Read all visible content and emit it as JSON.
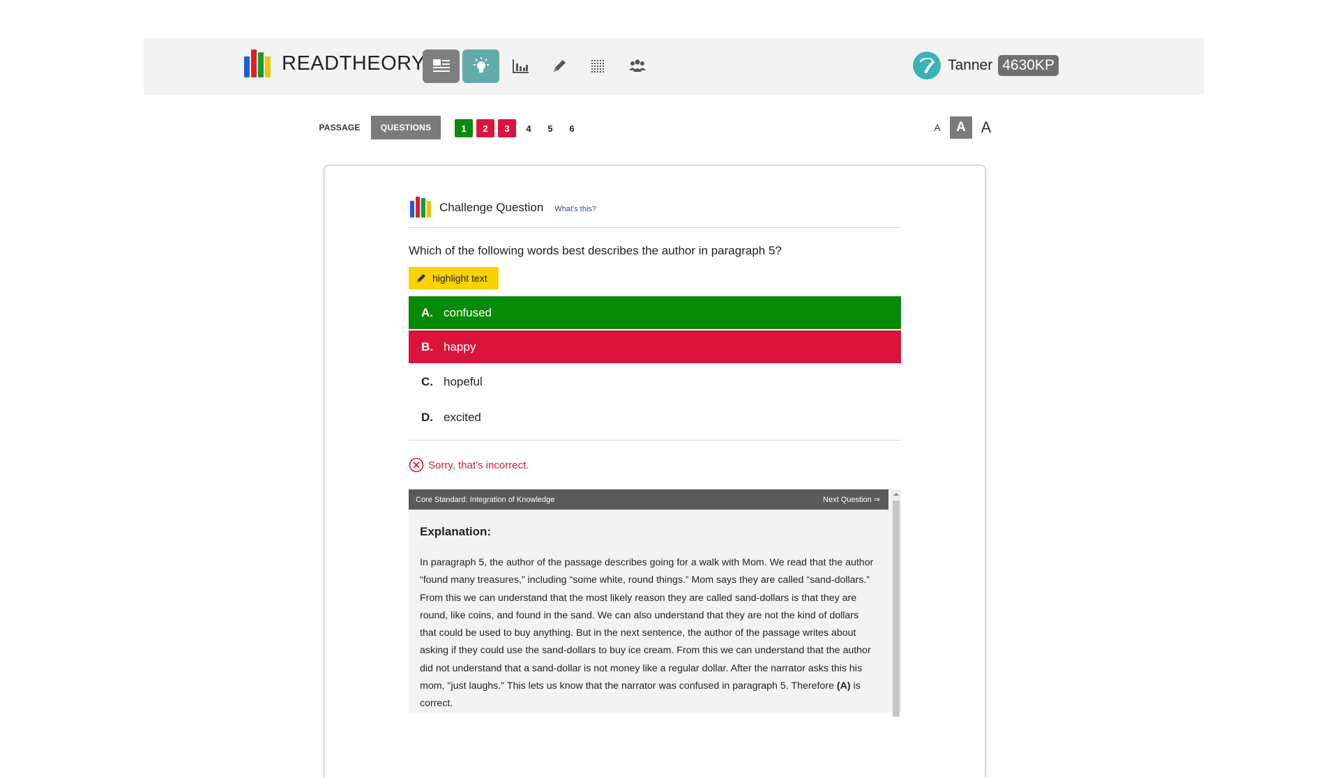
{
  "header": {
    "brand": "READTHEORY",
    "nav": [
      {
        "name": "passage-list-icon",
        "state": "active-grey"
      },
      {
        "name": "lightbulb-icon",
        "state": "active-teal"
      },
      {
        "name": "bar-chart-icon",
        "state": "plain"
      },
      {
        "name": "pencil-icon",
        "state": "plain"
      },
      {
        "name": "grid-icon",
        "state": "plain"
      },
      {
        "name": "group-icon",
        "state": "plain"
      }
    ],
    "user": {
      "name": "Tanner",
      "points": "4630KP"
    }
  },
  "subnav": {
    "passage_tab": "PASSAGE",
    "questions_tab": "QUESTIONS",
    "question_numbers": [
      {
        "label": "1",
        "status": "correct"
      },
      {
        "label": "2",
        "status": "incorrect"
      },
      {
        "label": "3",
        "status": "incorrect"
      },
      {
        "label": "4",
        "status": "unanswered"
      },
      {
        "label": "5",
        "status": "unanswered"
      },
      {
        "label": "6",
        "status": "unanswered"
      }
    ],
    "font_sizes": [
      "A",
      "A",
      "A"
    ]
  },
  "challenge": {
    "title": "Challenge Question",
    "whats_this": "What's this?"
  },
  "question": {
    "text": "Which of the following words best describes the author in paragraph 5?",
    "highlight_label": "highlight text"
  },
  "answers": [
    {
      "letter": "A.",
      "text": "confused",
      "status": "correct"
    },
    {
      "letter": "B.",
      "text": "happy",
      "status": "wrong"
    },
    {
      "letter": "C.",
      "text": "hopeful",
      "status": "plain"
    },
    {
      "letter": "D.",
      "text": "excited",
      "status": "plain"
    }
  ],
  "feedback": "Sorry, that's incorrect.",
  "explanation": {
    "standard": "Core Standard: Integration of Knowledge",
    "next": "Next Question ⇒",
    "title": "Explanation:",
    "text_before": "In paragraph 5, the author of the passage describes going for a walk with Mom. We read that the author “found many treasures,” including “some white, round things.” Mom says they are called “sand-dollars.” From this we can understand that the most likely reason they are called sand-dollars is that they are round, like coins, and found in the sand. We can also understand that they are not the kind of dollars that could be used to buy anything. But in the next sentence, the author of the passage writes about asking if they could use the sand-dollars to buy ice cream. From this we can understand that the author did not understand that a sand-dollar is not money like a regular dollar. After the narrator asks this his mom, \"just laughs.\" This lets us know that the narrator was confused in paragraph 5. Therefore ",
    "answer_ref": "(A)",
    "text_after": " is correct."
  },
  "colors": {
    "correct": "#078a07",
    "incorrect": "#dc143c",
    "highlight": "#f8d300",
    "teal": "#63aaab"
  }
}
